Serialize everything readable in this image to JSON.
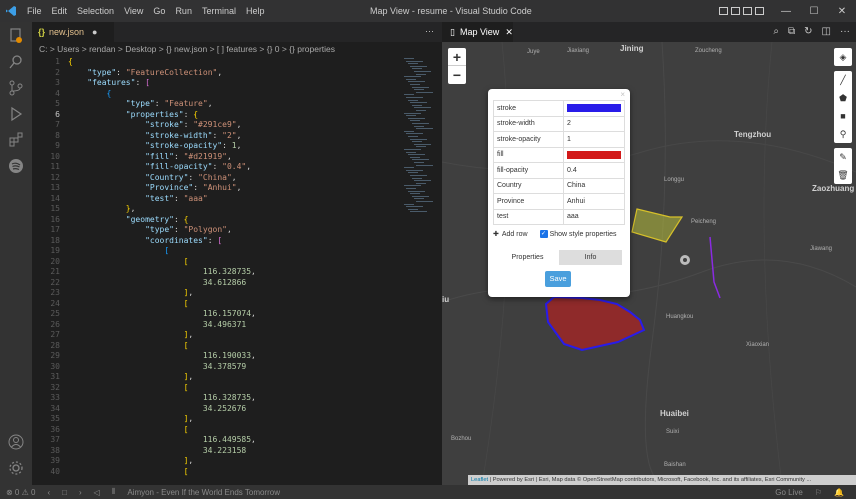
{
  "titlebar": {
    "logo": "vscode-logo",
    "menu": [
      "File",
      "Edit",
      "Selection",
      "View",
      "Go",
      "Run",
      "Terminal",
      "Help"
    ],
    "window_title": "Map View - resume - Visual Studio Code",
    "controls": [
      "—",
      "☐",
      "✕"
    ]
  },
  "editor": {
    "tab_label": "new.json",
    "more": "···",
    "breadcrumb": "C: > Users > rendan > Desktop > {} new.json > [ ] features > {} 0 > {} properties",
    "active_line": 6
  },
  "code_lines": [
    {
      "n": "1",
      "parts": [
        [
          "b1",
          "{"
        ]
      ]
    },
    {
      "n": "2",
      "parts": [
        [
          "p",
          "    "
        ],
        [
          "k",
          "\"type\""
        ],
        [
          "p",
          ": "
        ],
        [
          "s",
          "\"FeatureCollection\""
        ],
        [
          "p",
          ","
        ]
      ]
    },
    {
      "n": "3",
      "parts": [
        [
          "p",
          "    "
        ],
        [
          "k",
          "\"features\""
        ],
        [
          "p",
          ": "
        ],
        [
          "b2",
          "["
        ]
      ]
    },
    {
      "n": "4",
      "parts": [
        [
          "p",
          "        "
        ],
        [
          "b3",
          "{"
        ]
      ]
    },
    {
      "n": "5",
      "parts": [
        [
          "p",
          "            "
        ],
        [
          "k",
          "\"type\""
        ],
        [
          "p",
          ": "
        ],
        [
          "s",
          "\"Feature\""
        ],
        [
          "p",
          ","
        ]
      ]
    },
    {
      "n": "6",
      "parts": [
        [
          "p",
          "            "
        ],
        [
          "k",
          "\"properties\""
        ],
        [
          "p",
          ": "
        ],
        [
          "b1",
          "{"
        ]
      ]
    },
    {
      "n": "7",
      "parts": [
        [
          "p",
          "                "
        ],
        [
          "k",
          "\"stroke\""
        ],
        [
          "p",
          ": "
        ],
        [
          "s",
          "\"#291ce9\""
        ],
        [
          "p",
          ","
        ]
      ]
    },
    {
      "n": "8",
      "parts": [
        [
          "p",
          "                "
        ],
        [
          "k",
          "\"stroke-width\""
        ],
        [
          "p",
          ": "
        ],
        [
          "s",
          "\"2\""
        ],
        [
          "p",
          ","
        ]
      ]
    },
    {
      "n": "9",
      "parts": [
        [
          "p",
          "                "
        ],
        [
          "k",
          "\"stroke-opacity\""
        ],
        [
          "p",
          ": "
        ],
        [
          "n",
          "1"
        ],
        [
          "p",
          ","
        ]
      ]
    },
    {
      "n": "10",
      "parts": [
        [
          "p",
          "                "
        ],
        [
          "k",
          "\"fill\""
        ],
        [
          "p",
          ": "
        ],
        [
          "s",
          "\"#d21919\""
        ],
        [
          "p",
          ","
        ]
      ]
    },
    {
      "n": "11",
      "parts": [
        [
          "p",
          "                "
        ],
        [
          "k",
          "\"fill-opacity\""
        ],
        [
          "p",
          ": "
        ],
        [
          "s",
          "\"0.4\""
        ],
        [
          "p",
          ","
        ]
      ]
    },
    {
      "n": "12",
      "parts": [
        [
          "p",
          "                "
        ],
        [
          "k",
          "\"Country\""
        ],
        [
          "p",
          ": "
        ],
        [
          "s",
          "\"China\""
        ],
        [
          "p",
          ","
        ]
      ]
    },
    {
      "n": "13",
      "parts": [
        [
          "p",
          "                "
        ],
        [
          "k",
          "\"Province\""
        ],
        [
          "p",
          ": "
        ],
        [
          "s",
          "\"Anhui\""
        ],
        [
          "p",
          ","
        ]
      ]
    },
    {
      "n": "14",
      "parts": [
        [
          "p",
          "                "
        ],
        [
          "k",
          "\"test\""
        ],
        [
          "p",
          ": "
        ],
        [
          "s",
          "\"aaa\""
        ]
      ]
    },
    {
      "n": "15",
      "parts": [
        [
          "p",
          "            "
        ],
        [
          "b1",
          "}"
        ],
        [
          "p",
          ","
        ]
      ]
    },
    {
      "n": "16",
      "parts": [
        [
          "p",
          "            "
        ],
        [
          "k",
          "\"geometry\""
        ],
        [
          "p",
          ": "
        ],
        [
          "b1",
          "{"
        ]
      ]
    },
    {
      "n": "17",
      "parts": [
        [
          "p",
          "                "
        ],
        [
          "k",
          "\"type\""
        ],
        [
          "p",
          ": "
        ],
        [
          "s",
          "\"Polygon\""
        ],
        [
          "p",
          ","
        ]
      ]
    },
    {
      "n": "18",
      "parts": [
        [
          "p",
          "                "
        ],
        [
          "k",
          "\"coordinates\""
        ],
        [
          "p",
          ": "
        ],
        [
          "b2",
          "["
        ]
      ]
    },
    {
      "n": "19",
      "parts": [
        [
          "p",
          "                    "
        ],
        [
          "b3",
          "["
        ]
      ]
    },
    {
      "n": "20",
      "parts": [
        [
          "p",
          "                        "
        ],
        [
          "b1",
          "["
        ]
      ]
    },
    {
      "n": "21",
      "parts": [
        [
          "p",
          "                            "
        ],
        [
          "n",
          "116.328735"
        ],
        [
          "p",
          ","
        ]
      ]
    },
    {
      "n": "22",
      "parts": [
        [
          "p",
          "                            "
        ],
        [
          "n",
          "34.612866"
        ]
      ]
    },
    {
      "n": "23",
      "parts": [
        [
          "p",
          "                        "
        ],
        [
          "b1",
          "]"
        ],
        [
          "p",
          ","
        ]
      ]
    },
    {
      "n": "24",
      "parts": [
        [
          "p",
          "                        "
        ],
        [
          "b1",
          "["
        ]
      ]
    },
    {
      "n": "25",
      "parts": [
        [
          "p",
          "                            "
        ],
        [
          "n",
          "116.157074"
        ],
        [
          "p",
          ","
        ]
      ]
    },
    {
      "n": "26",
      "parts": [
        [
          "p",
          "                            "
        ],
        [
          "n",
          "34.496371"
        ]
      ]
    },
    {
      "n": "27",
      "parts": [
        [
          "p",
          "                        "
        ],
        [
          "b1",
          "]"
        ],
        [
          "p",
          ","
        ]
      ]
    },
    {
      "n": "28",
      "parts": [
        [
          "p",
          "                        "
        ],
        [
          "b1",
          "["
        ]
      ]
    },
    {
      "n": "29",
      "parts": [
        [
          "p",
          "                            "
        ],
        [
          "n",
          "116.190033"
        ],
        [
          "p",
          ","
        ]
      ]
    },
    {
      "n": "30",
      "parts": [
        [
          "p",
          "                            "
        ],
        [
          "n",
          "34.378579"
        ]
      ]
    },
    {
      "n": "31",
      "parts": [
        [
          "p",
          "                        "
        ],
        [
          "b1",
          "]"
        ],
        [
          "p",
          ","
        ]
      ]
    },
    {
      "n": "32",
      "parts": [
        [
          "p",
          "                        "
        ],
        [
          "b1",
          "["
        ]
      ]
    },
    {
      "n": "33",
      "parts": [
        [
          "p",
          "                            "
        ],
        [
          "n",
          "116.328735"
        ],
        [
          "p",
          ","
        ]
      ]
    },
    {
      "n": "34",
      "parts": [
        [
          "p",
          "                            "
        ],
        [
          "n",
          "34.252676"
        ]
      ]
    },
    {
      "n": "35",
      "parts": [
        [
          "p",
          "                        "
        ],
        [
          "b1",
          "]"
        ],
        [
          "p",
          ","
        ]
      ]
    },
    {
      "n": "36",
      "parts": [
        [
          "p",
          "                        "
        ],
        [
          "b1",
          "["
        ]
      ]
    },
    {
      "n": "37",
      "parts": [
        [
          "p",
          "                            "
        ],
        [
          "n",
          "116.449585"
        ],
        [
          "p",
          ","
        ]
      ]
    },
    {
      "n": "38",
      "parts": [
        [
          "p",
          "                            "
        ],
        [
          "n",
          "34.223158"
        ]
      ]
    },
    {
      "n": "39",
      "parts": [
        [
          "p",
          "                        "
        ],
        [
          "b1",
          "]"
        ],
        [
          "p",
          ","
        ]
      ]
    },
    {
      "n": "40",
      "parts": [
        [
          "p",
          "                        "
        ],
        [
          "b1",
          "["
        ]
      ]
    }
  ],
  "map_tab": {
    "label": "Map View",
    "close": "✕"
  },
  "map": {
    "zoom_in": "+",
    "zoom_out": "−",
    "labels": [
      {
        "text": "Jining",
        "big": true
      },
      {
        "text": "Jiaxiang",
        "big": false
      },
      {
        "text": "Juye",
        "big": false
      },
      {
        "text": "Zoucheng",
        "big": false
      },
      {
        "text": "Tengzhou",
        "big": true
      },
      {
        "text": "Zaozhuang",
        "big": true
      },
      {
        "text": "Longgu",
        "big": false
      },
      {
        "text": "Peicheng",
        "big": false
      },
      {
        "text": "Jiawang",
        "big": false
      },
      {
        "text": "Huangkou",
        "big": false
      },
      {
        "text": "Xiaoxian",
        "big": false
      },
      {
        "text": "Huaibei",
        "big": true
      },
      {
        "text": "Suixi",
        "big": false
      },
      {
        "text": "Bozhou",
        "big": false
      },
      {
        "text": "Baishan",
        "big": false
      },
      {
        "text": "iu",
        "big": true
      }
    ],
    "attribution_link": "Leaflet",
    "attribution_text": " | Powered by Esri | Esri, Map data © OpenStreetMap contributors, Microsoft, Facebook, Inc. and its affiliates, Esri Community ..."
  },
  "popup": {
    "close": "×",
    "rows": [
      {
        "key": "stroke",
        "value": "",
        "swatch": "#291ce9"
      },
      {
        "key": "stroke-width",
        "value": "2"
      },
      {
        "key": "stroke-opacity",
        "value": "1"
      },
      {
        "key": "fill",
        "value": "",
        "swatch": "#d21919"
      },
      {
        "key": "fill-opacity",
        "value": "0.4"
      },
      {
        "key": "Country",
        "value": "China"
      },
      {
        "key": "Province",
        "value": "Anhui"
      },
      {
        "key": "test",
        "value": "aaa"
      }
    ],
    "add_row": "Add row",
    "show_style": "Show style properties",
    "tab_properties": "Properties",
    "tab_info": "Info",
    "save": "Save"
  },
  "statusbar": {
    "problems": "⊗ 0 ⚠ 0",
    "media": "Aimyon - Even If the World Ends Tomorrow",
    "go_live": "Go Live"
  }
}
